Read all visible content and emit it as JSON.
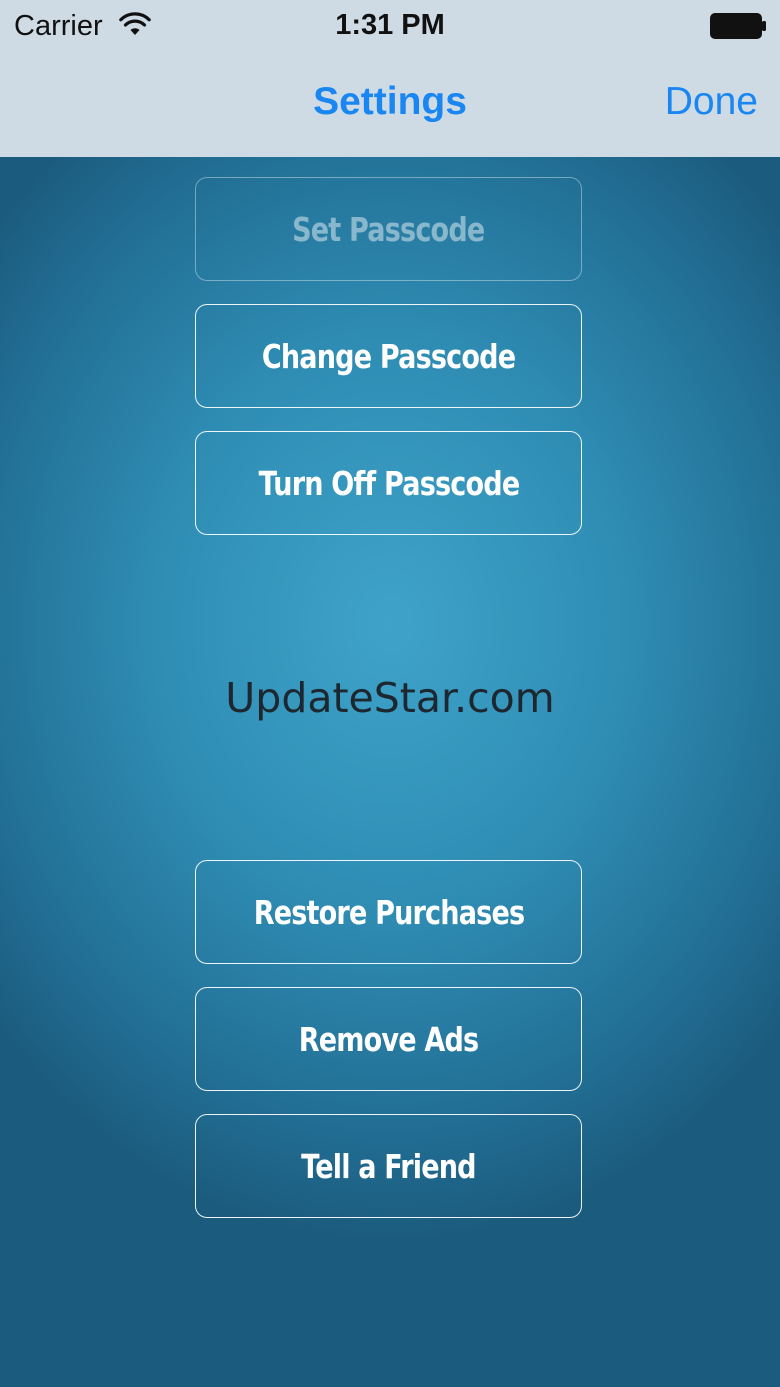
{
  "status_bar": {
    "carrier": "Carrier",
    "time": "1:31 PM",
    "wifi_icon": "wifi-icon",
    "battery_icon": "battery-icon"
  },
  "nav": {
    "title": "Settings",
    "done_label": "Done"
  },
  "buttons": {
    "set_passcode": "Set Passcode",
    "change_passcode": "Change Passcode",
    "turn_off_passcode": "Turn Off Passcode",
    "restore_purchases": "Restore Purchases",
    "remove_ads": "Remove Ads",
    "tell_a_friend": "Tell a Friend"
  },
  "watermark": "UpdateStar.com",
  "colors": {
    "accent": "#1a86f2",
    "header_bg": "#cfdbe4",
    "background_center": "#3fa3c9",
    "background_edge": "#1b5b7d"
  }
}
